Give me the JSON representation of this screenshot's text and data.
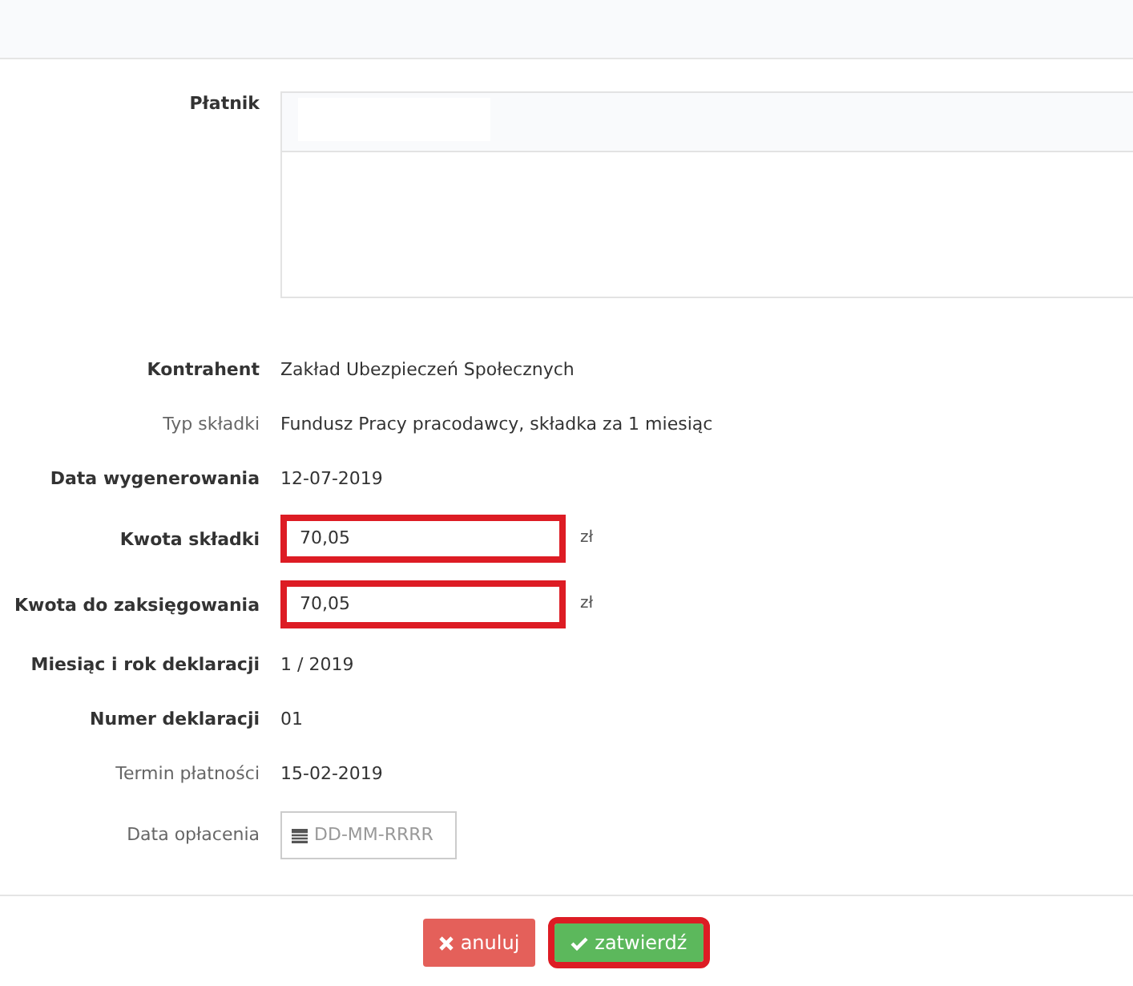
{
  "payer": {
    "label": "Płatnik"
  },
  "rows": [
    {
      "kind": "text",
      "label": "Kontrahent",
      "bold": true,
      "value": "Zakład Ubezpieczeń Społecznych"
    },
    {
      "kind": "text",
      "label": "Typ składki",
      "bold": false,
      "value": "Fundusz Pracy pracodawcy, składka za 1 miesiąc"
    },
    {
      "kind": "text",
      "label": "Data wygenerowania",
      "bold": true,
      "value": "12-07-2019"
    },
    {
      "kind": "input",
      "label": "Kwota składki",
      "bold": true,
      "value": "70,05",
      "unit": "zł",
      "highlighted": true
    },
    {
      "kind": "input",
      "label": "Kwota do zaksięgowania",
      "bold": true,
      "value": "70,05",
      "unit": "zł",
      "highlighted": true
    },
    {
      "kind": "text",
      "label": "Miesiąc i rok deklaracji",
      "bold": true,
      "value": "1 / 2019"
    },
    {
      "kind": "text",
      "label": "Numer deklaracji",
      "bold": true,
      "value": "01"
    },
    {
      "kind": "text",
      "label": "Termin płatności",
      "bold": false,
      "value": "15-02-2019"
    },
    {
      "kind": "date",
      "label": "Data opłacenia",
      "bold": false,
      "placeholder": "DD-MM-RRRR"
    }
  ],
  "buttons": [
    {
      "kind": "cancel",
      "label": "anuluj",
      "highlighted": false
    },
    {
      "kind": "confirm",
      "label": "zatwierdź",
      "highlighted": true
    }
  ]
}
